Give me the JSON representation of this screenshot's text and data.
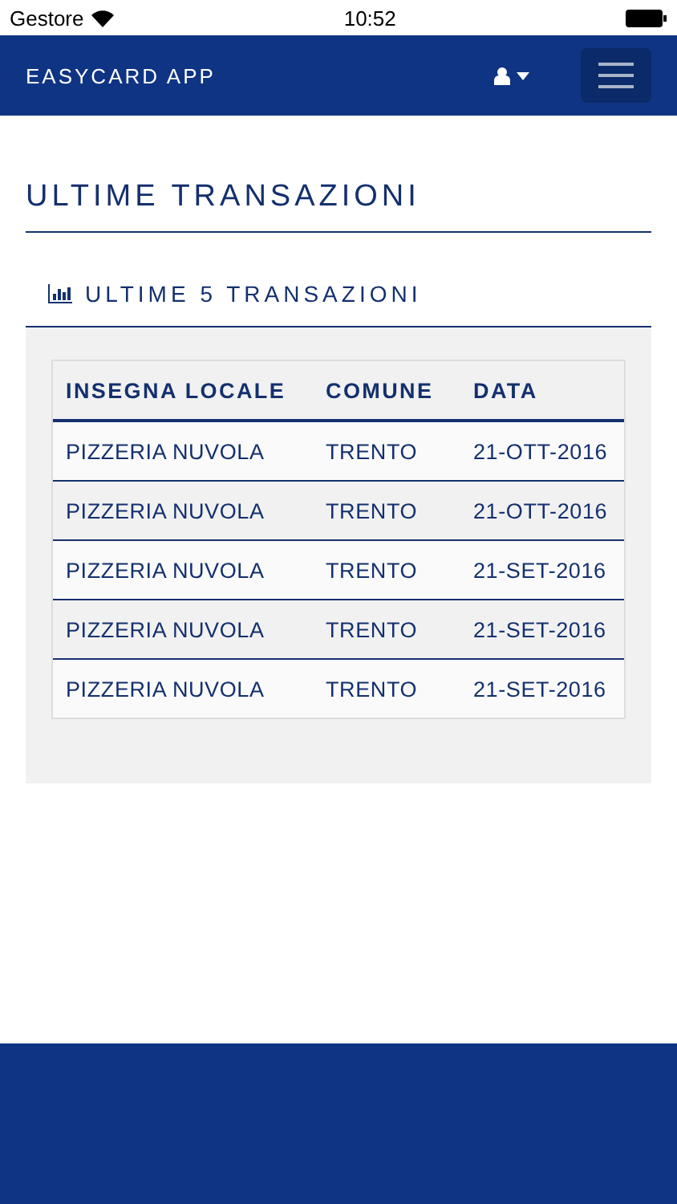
{
  "status_bar": {
    "carrier": "Gestore",
    "time": "10:52"
  },
  "navbar": {
    "brand": "EASYCARD APP"
  },
  "page_title": "ULTIME TRANSAZIONI",
  "section": {
    "title": "ULTIME 5 TRANSAZIONI"
  },
  "table": {
    "columns": [
      "INSEGNA LOCALE",
      "COMUNE",
      "DATA"
    ],
    "rows": [
      [
        "PIZZERIA NUVOLA",
        "TRENTO",
        "21-OTT-2016"
      ],
      [
        "PIZZERIA NUVOLA",
        "TRENTO",
        "21-OTT-2016"
      ],
      [
        "PIZZERIA NUVOLA",
        "TRENTO",
        "21-SET-2016"
      ],
      [
        "PIZZERIA NUVOLA",
        "TRENTO",
        "21-SET-2016"
      ],
      [
        "PIZZERIA NUVOLA",
        "TRENTO",
        "21-SET-2016"
      ]
    ]
  }
}
